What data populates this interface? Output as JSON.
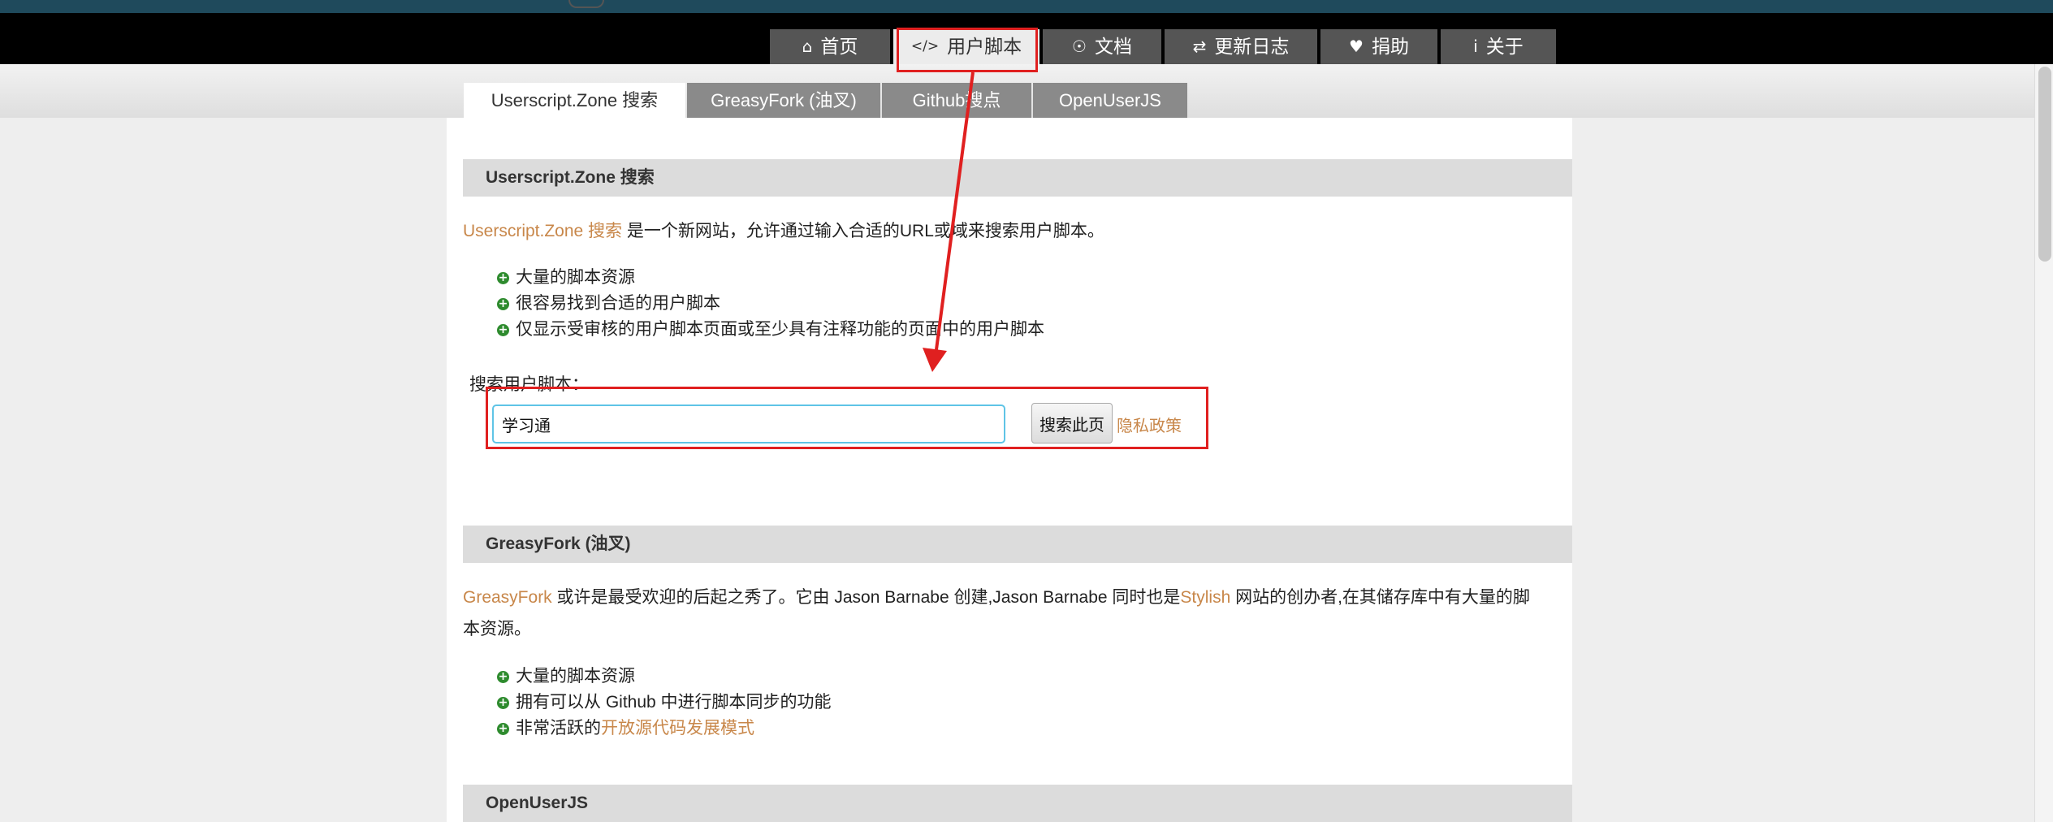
{
  "nav": {
    "items": [
      {
        "icon": "home-icon",
        "glyph": "⌂",
        "label": "首页"
      },
      {
        "icon": "code-icon",
        "glyph": "</>",
        "label": "用户脚本"
      },
      {
        "icon": "bulb-icon",
        "glyph": "☉",
        "label": "文档"
      },
      {
        "icon": "exchange-icon",
        "glyph": "⇄",
        "label": "更新日志"
      },
      {
        "icon": "heart-icon",
        "glyph": "♥",
        "label": "捐助"
      },
      {
        "icon": "info-icon",
        "glyph": "i",
        "label": "关于"
      }
    ]
  },
  "tabs": [
    "Userscript.Zone 搜索",
    "GreasyFork (油叉)",
    "Github搜点",
    "OpenUserJS"
  ],
  "sections": {
    "zone": {
      "title": "Userscript.Zone 搜索",
      "link": "Userscript.Zone 搜索",
      "desc": " 是一个新网站，允许通过输入合适的URL或域来搜索用户脚本。",
      "features": [
        "大量的脚本资源",
        "很容易找到合适的用户脚本",
        "仅显示受审核的用户脚本页面或至少具有注释功能的页面中的用户脚本"
      ],
      "search_label": "搜索用户脚本：",
      "search_value": "学习通",
      "search_button": "搜索此页",
      "privacy": "隐私政策"
    },
    "greasyfork": {
      "title": "GreasyFork (油叉)",
      "link1": "GreasyFork",
      "desc1": " 或许是最受欢迎的后起之秀了。它由 Jason Barnabe 创建,Jason Barnabe 同时也是",
      "link2": "Stylish",
      "desc2": " 网站的创办者,在其储存库中有大量的脚",
      "desc3": "本资源。",
      "features": [
        "大量的脚本资源",
        "拥有可以从 Github 中进行脚本同步的功能"
      ],
      "feature3_prefix": "非常活跃的",
      "feature3_link": "开放源代码发展模式"
    },
    "openuserjs": {
      "title": "OpenUserJS"
    }
  },
  "colors": {
    "link": "#c8874a",
    "annotation": "#e02020",
    "nav_bg": "#000000",
    "feature_icon": "#2e8b2e"
  }
}
